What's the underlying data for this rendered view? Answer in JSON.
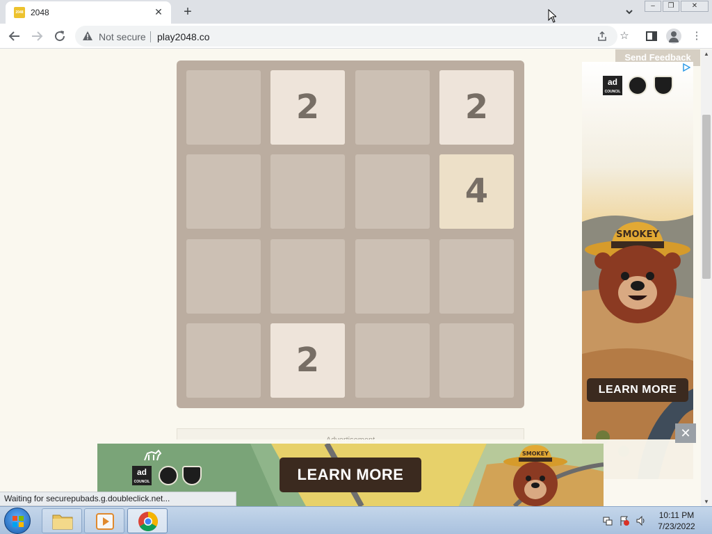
{
  "browser": {
    "tab": {
      "favicon_text": "2048",
      "title": "2048"
    },
    "window_controls": {
      "minimize": "–",
      "restore": "❐",
      "close": "✕"
    },
    "omnibox": {
      "security_label": "Not secure",
      "url": "play2048.co"
    },
    "icons": {
      "back": "back-arrow-icon",
      "forward": "forward-arrow-icon",
      "reload": "reload-icon",
      "share": "share-icon",
      "bookmark": "star-icon",
      "sidepanel": "side-panel-icon",
      "profile": "profile-icon",
      "menu": "kebab-menu-icon"
    }
  },
  "game": {
    "grid_size": 4,
    "tiles": [
      {
        "row": 0,
        "col": 1,
        "value": "2"
      },
      {
        "row": 0,
        "col": 3,
        "value": "2"
      },
      {
        "row": 1,
        "col": 3,
        "value": "4"
      },
      {
        "row": 3,
        "col": 1,
        "value": "2"
      }
    ],
    "colors": {
      "board": "#bbada0",
      "tile_2": "#eee4da",
      "tile_4": "#ede0c8",
      "text": "#776e65"
    }
  },
  "page": {
    "send_feedback": "Send Feedback",
    "advertisement_label": "Advertisement"
  },
  "side_ad": {
    "ad_council_text": "ad",
    "ad_council_sub": "COUNCIL",
    "hat_text": "SMOKEY",
    "learn_more": "LEARN MORE"
  },
  "bottom_ad": {
    "ad_council_text": "ad",
    "ad_council_sub": "COUNCIL",
    "hat_text": "SMOKEY",
    "learn_more": "LEARN MORE",
    "close": "✕"
  },
  "status_bar": {
    "text": "Waiting for securepubads.g.doubleclick.net..."
  },
  "taskbar": {
    "apps": [
      "file-explorer",
      "media-player",
      "chrome"
    ],
    "time": "10:11 PM",
    "date": "7/23/2022"
  }
}
